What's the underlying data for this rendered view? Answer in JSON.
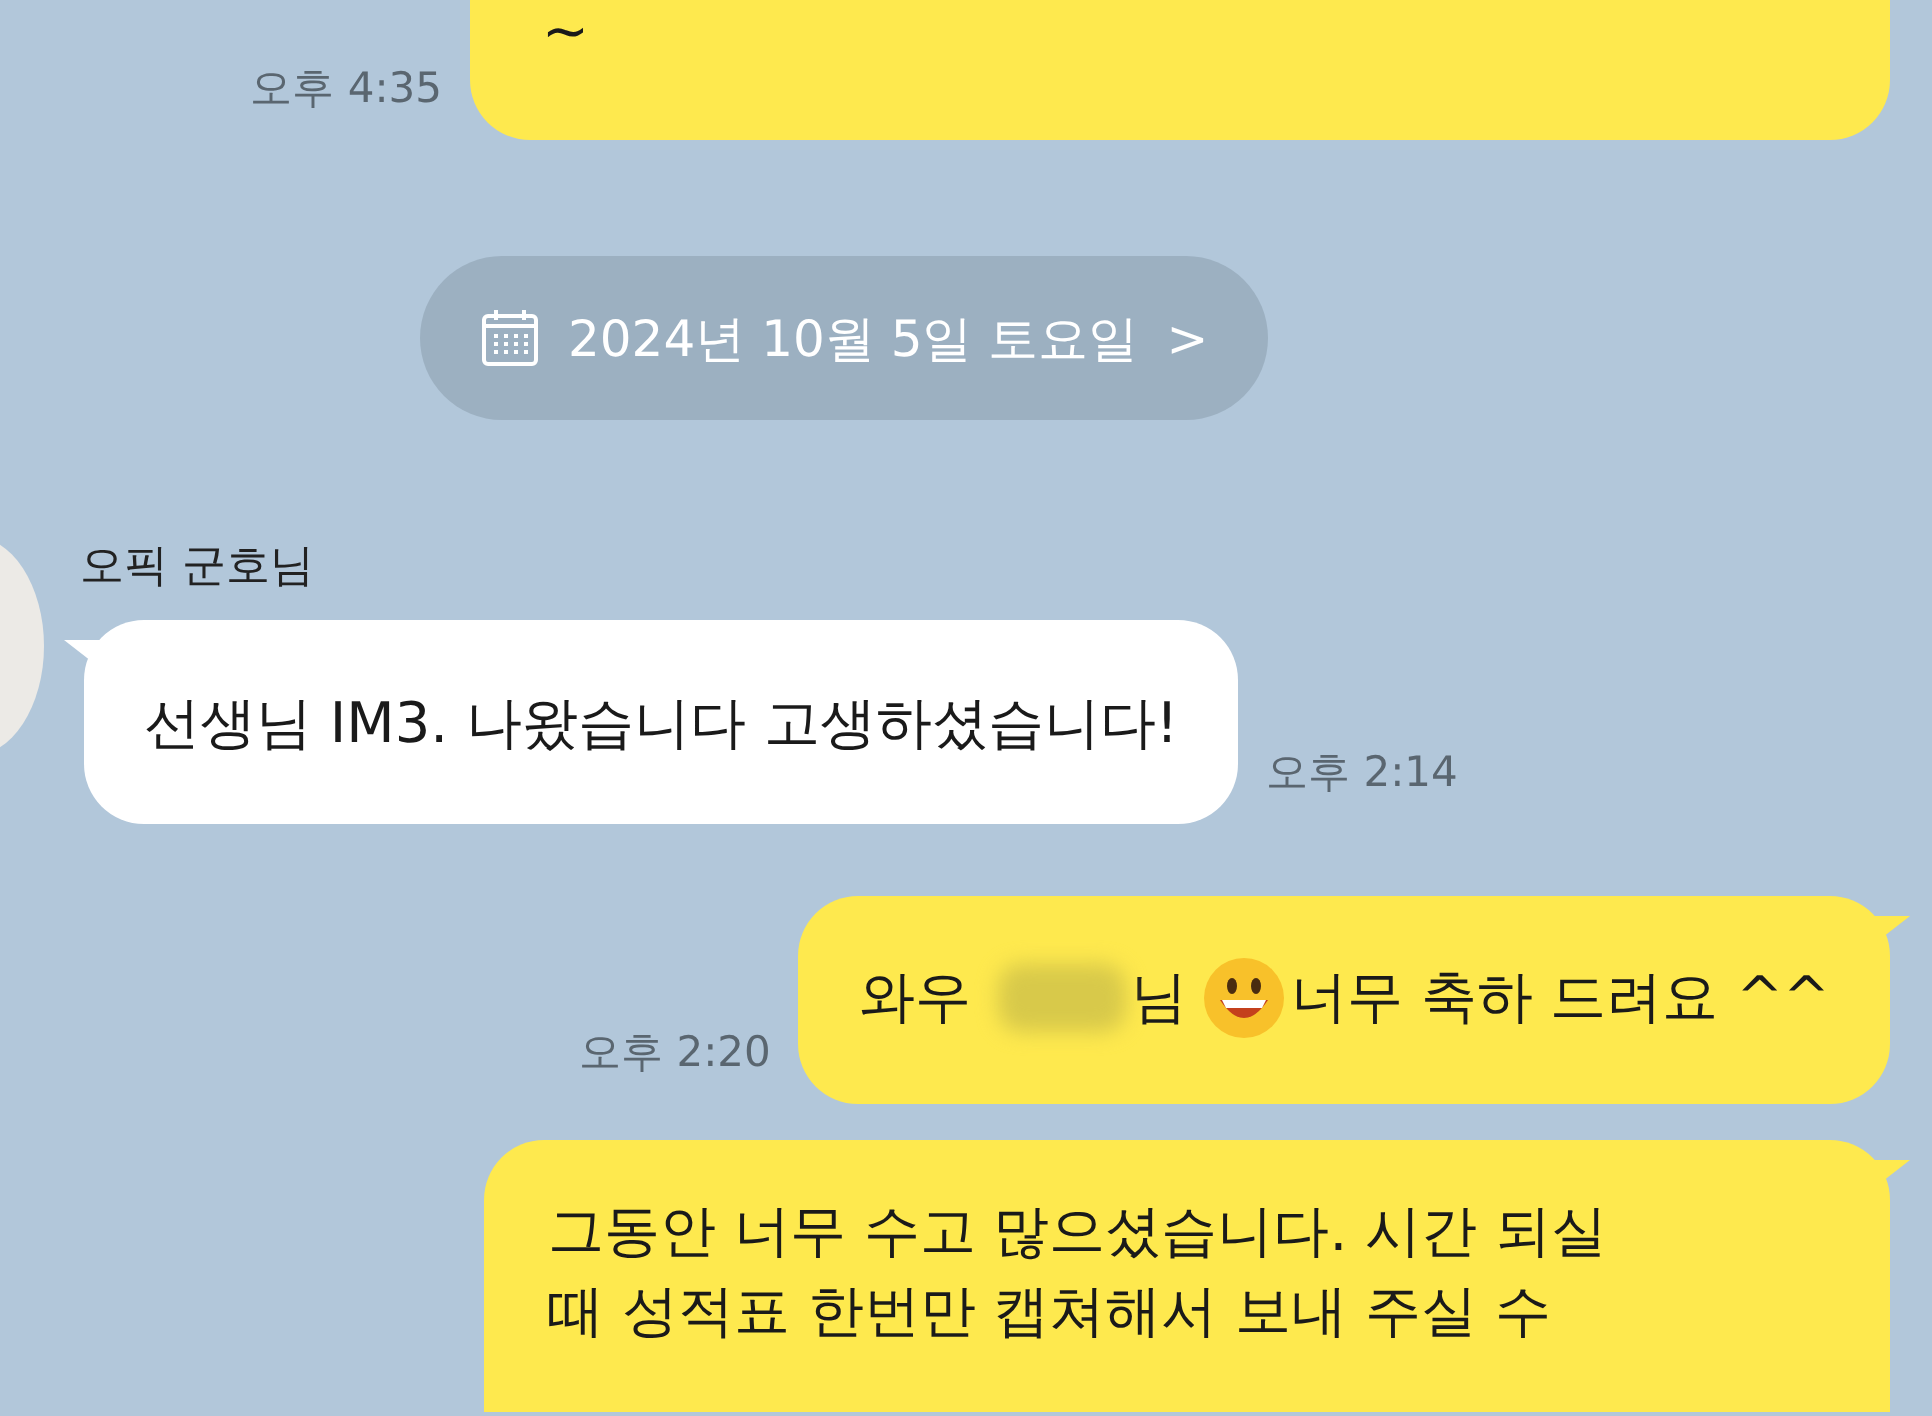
{
  "messages": [
    {
      "kind": "mine",
      "segments": [
        {
          "kind": "text",
          "text": "~"
        }
      ],
      "time": "오후 4:35"
    },
    {
      "kind": "date",
      "text": "2024년 10월 5일 토요일",
      "arrow": ">"
    },
    {
      "kind": "theirs",
      "sender": "오픽 군호님",
      "segments": [
        {
          "kind": "text",
          "text": "선생님 IM3. 나왔습니다 고생하셨습니다!"
        }
      ],
      "time": "오후 2:14"
    },
    {
      "kind": "mine",
      "segments": [
        {
          "kind": "text",
          "text": "와우"
        },
        {
          "kind": "blur"
        },
        {
          "kind": "text",
          "text": "님"
        },
        {
          "kind": "emoji"
        },
        {
          "kind": "text",
          "text": "너무 축하 드려요 ^^"
        }
      ],
      "time": "오후 2:20"
    },
    {
      "kind": "mine",
      "segments": [
        {
          "kind": "line",
          "text": "그동안 너무 수고 많으셨습니다. 시간 되실"
        },
        {
          "kind": "line",
          "text": "때 성적표 한번만 캡쳐해서 보내 주실 수"
        }
      ]
    }
  ]
}
